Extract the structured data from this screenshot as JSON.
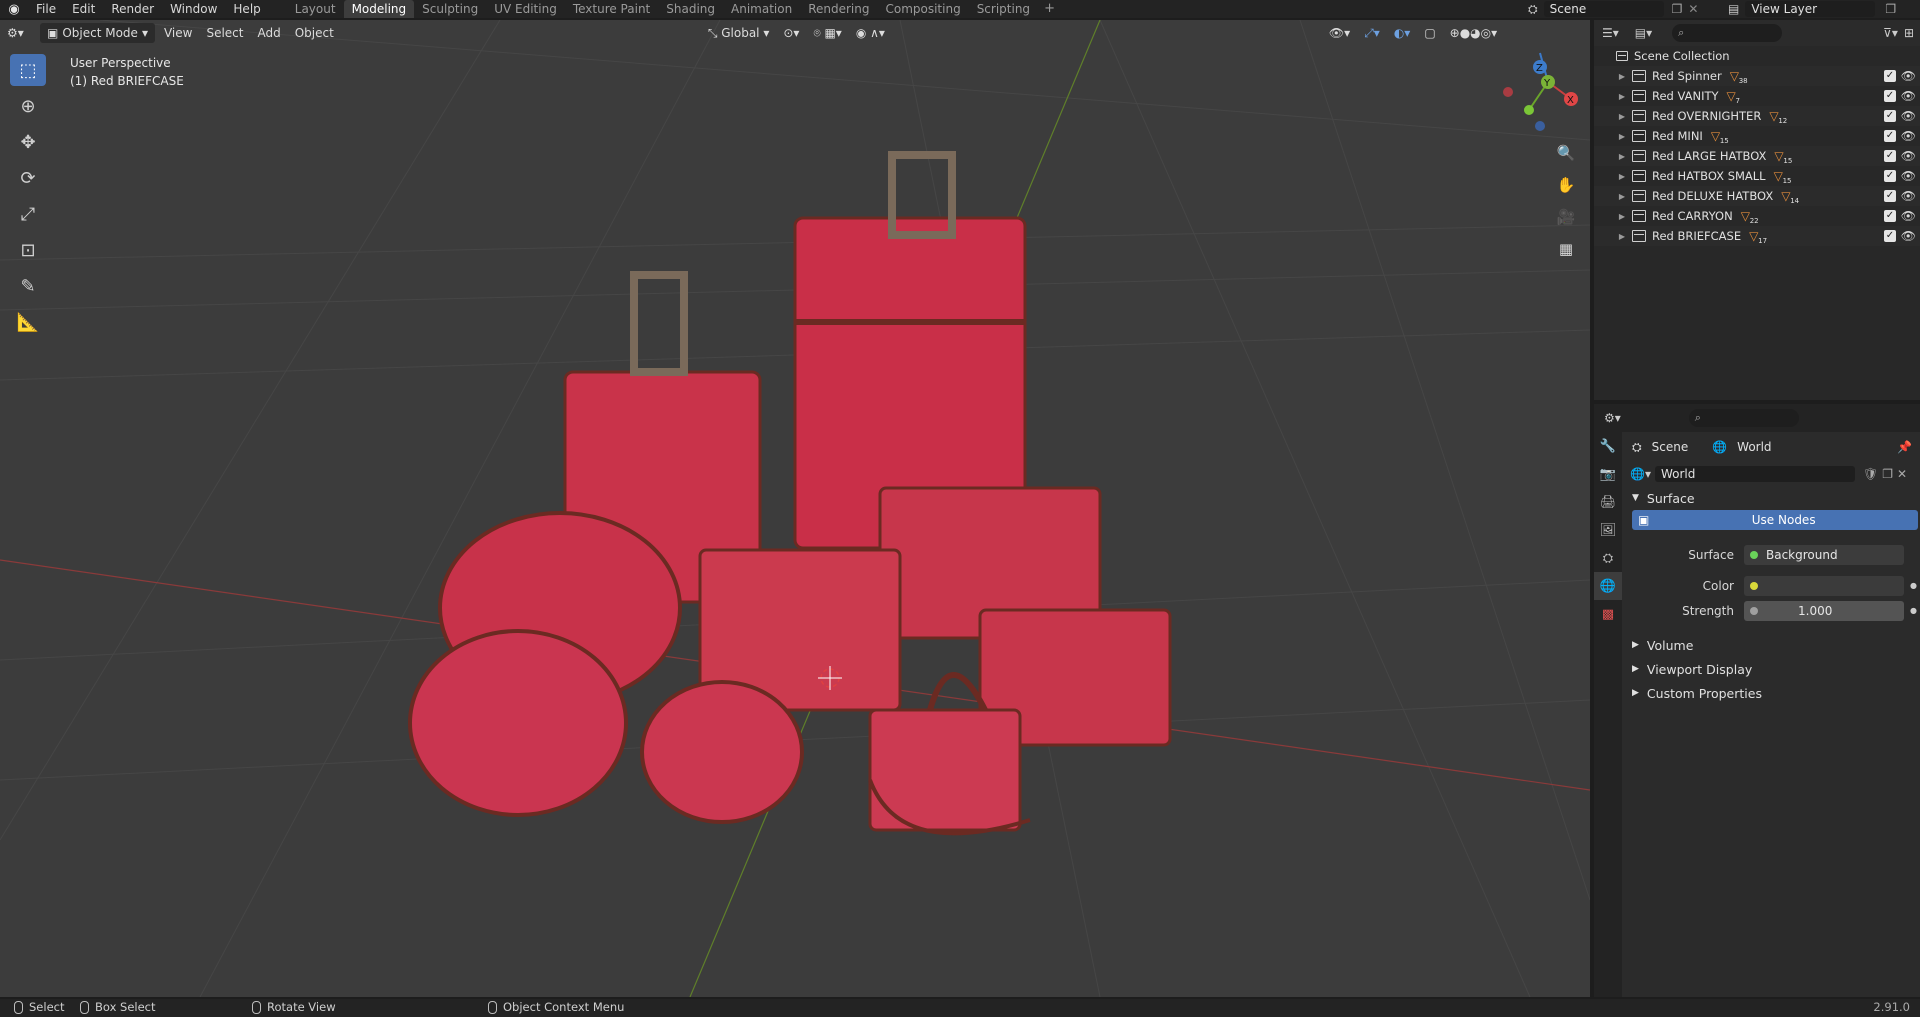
{
  "menu": [
    "File",
    "Edit",
    "Render",
    "Window",
    "Help"
  ],
  "workspaces": [
    "Layout",
    "Modeling",
    "Sculpting",
    "UV Editing",
    "Texture Paint",
    "Shading",
    "Animation",
    "Rendering",
    "Compositing",
    "Scripting"
  ],
  "active_workspace": "Modeling",
  "scene_name": "Scene",
  "view_layer": "View Layer",
  "viewport": {
    "mode": "Object Mode",
    "menus": [
      "View",
      "Select",
      "Add",
      "Object"
    ],
    "transform_orientation": "Global",
    "info_line1": "User Perspective",
    "info_line2": "(1) Red  BRIEFCASE",
    "gizmo_axes": {
      "x": "X",
      "y": "Y",
      "z": "Z"
    }
  },
  "outliner": {
    "root": "Scene Collection",
    "items": [
      {
        "label": "Red  Spinner",
        "count": "38"
      },
      {
        "label": "Red  VANITY",
        "count": "7"
      },
      {
        "label": "Red  OVERNIGHTER",
        "count": "12"
      },
      {
        "label": "Red MINI",
        "count": "15"
      },
      {
        "label": "Red LARGE HATBOX",
        "count": "15"
      },
      {
        "label": "Red  HATBOX SMALL",
        "count": "15"
      },
      {
        "label": "Red  DELUXE HATBOX",
        "count": "14"
      },
      {
        "label": "Red  CARRYON",
        "count": "22"
      },
      {
        "label": "Red  BRIEFCASE",
        "count": "17"
      }
    ]
  },
  "properties": {
    "breadcrumb_scene": "Scene",
    "breadcrumb_world": "World",
    "world_name": "World",
    "surface_panel": "Surface",
    "use_nodes": "Use Nodes",
    "surface_label": "Surface",
    "surface_value": "Background",
    "color_label": "Color",
    "strength_label": "Strength",
    "strength_value": "1.000",
    "collapsed_panels": [
      "Volume",
      "Viewport Display",
      "Custom Properties"
    ],
    "colors": {
      "node_dot": "#6ad35a",
      "color_dot": "#d8d83a",
      "accent": "#4772b3"
    }
  },
  "statusbar": {
    "select": "Select",
    "box_select": "Box Select",
    "rotate_view": "Rotate View",
    "context_menu": "Object Context Menu",
    "version": "2.91.0"
  }
}
